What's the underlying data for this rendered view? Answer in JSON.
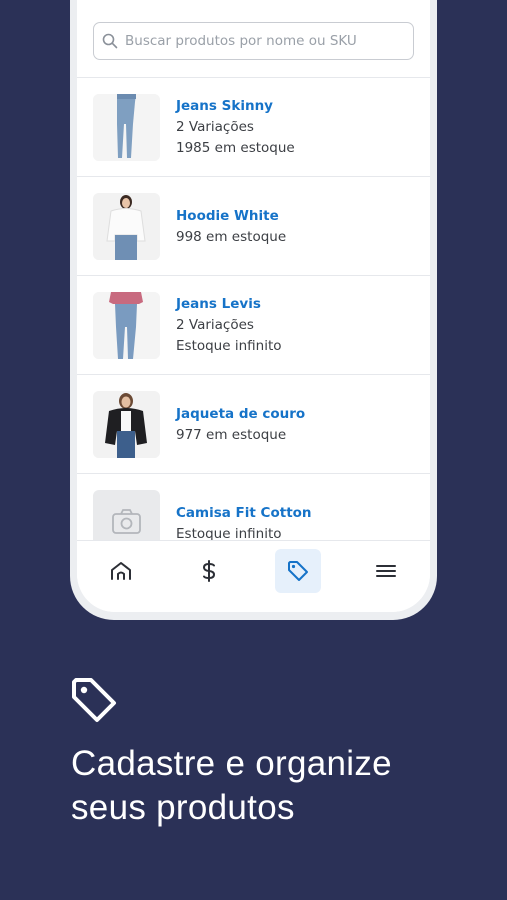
{
  "search": {
    "placeholder": "Buscar produtos por nome ou SKU"
  },
  "products": [
    {
      "name": "Jeans Skinny",
      "lines": [
        "2 Variações",
        "1985 em estoque"
      ],
      "thumb": "jeans-skinny-photo"
    },
    {
      "name": "Hoodie White",
      "lines": [
        "998 em estoque"
      ],
      "thumb": "hoodie-white-photo"
    },
    {
      "name": "Jeans Levis",
      "lines": [
        "2 Variações",
        "Estoque infinito"
      ],
      "thumb": "jeans-levis-photo"
    },
    {
      "name": "Jaqueta de couro",
      "lines": [
        "977 em estoque"
      ],
      "thumb": "jaqueta-couro-photo"
    },
    {
      "name": "Camisa Fit Cotton",
      "lines": [
        "Estoque infinito"
      ],
      "thumb": "camera-placeholder-icon"
    }
  ],
  "nav": {
    "items": [
      "home-icon",
      "dollar-icon",
      "tag-icon",
      "menu-icon"
    ],
    "active": "tag-icon",
    "accent": "#1673c8"
  },
  "promo": {
    "headline_line1": "Cadastre e organize",
    "headline_line2": "seus produtos"
  },
  "colors": {
    "background": "#2b3157",
    "link": "#1673c8"
  }
}
